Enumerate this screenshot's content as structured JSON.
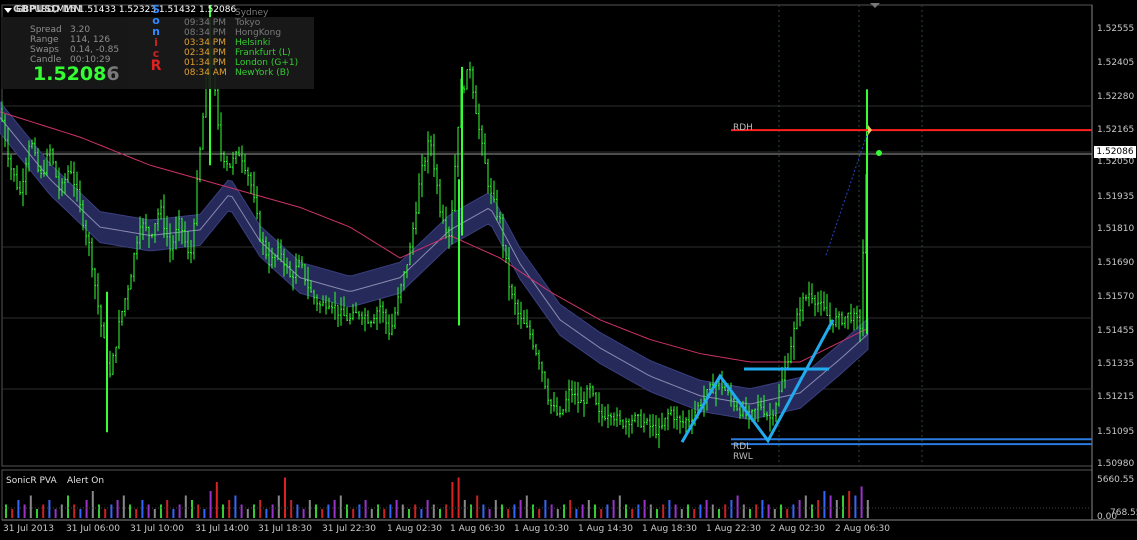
{
  "symbol_bar": {
    "text": "GBPUSD,M15  1.51433 1.52323 1.51432 1.52086"
  },
  "info_panel": {
    "pair_label": "GBPUSD  MN",
    "spread_label": "Spread",
    "spread_value": "3.20",
    "range_label": "Range",
    "range_value": "114, 126",
    "swaps_label": "Swaps",
    "swaps_value": "0.14, -0.85",
    "candle_label": "Candle",
    "candle_value": "00:10:29",
    "big_price_main": "1.5208",
    "big_price_last": "6",
    "sonic_letters": [
      "S",
      "o",
      "n",
      "i",
      "c",
      "R"
    ],
    "sonic_colors": [
      "#3388ff",
      "#3388ff",
      "#3388ff",
      "#cc2222",
      "#cc2222",
      "#dd2222"
    ],
    "sessions": [
      {
        "time": "",
        "name": "Sydney",
        "color": "#7a7a7a"
      },
      {
        "time": "09:34 PM",
        "name": "Tokyo",
        "color": "#7a7a7a"
      },
      {
        "time": "08:34 PM",
        "name": "HongKong",
        "color": "#7a7a7a"
      },
      {
        "time": "03:34 PM",
        "name": "Helsinki",
        "color": "#33cc33"
      },
      {
        "time": "02:34 PM",
        "name": "Frankfurt  (L)",
        "color": "#33cc33"
      },
      {
        "time": "01:34 PM",
        "name": "London  (G+1)",
        "color": "#33cc33"
      },
      {
        "time": "08:34 AM",
        "name": "NewYork  (B)",
        "color": "#33cc33"
      }
    ],
    "session_time_colors": [
      "#7a7a7a",
      "#7a7a7a",
      "#7a7a7a",
      "#e0a030",
      "#e0a030",
      "#e0a030",
      "#e0a030"
    ]
  },
  "price_axis": {
    "labels": [
      "1.52555",
      "1.52405",
      "1.52280",
      "1.52165",
      "1.52050",
      "1.51935",
      "1.51810",
      "1.51690",
      "1.51570",
      "1.51455",
      "1.51335",
      "1.51215",
      "1.51095",
      "1.50980"
    ],
    "current_price": "1.52086"
  },
  "time_axis": {
    "labels": [
      "31 Jul 2013",
      "31 Jul 06:00",
      "31 Jul 10:00",
      "31 Jul 14:00",
      "31 Jul 18:30",
      "31 Jul 22:30",
      "1 Aug 02:30",
      "1 Aug 06:30",
      "1 Aug 10:30",
      "1 Aug 14:30",
      "1 Aug 18:30",
      "1 Aug 22:30",
      "2 Aug 02:30",
      "2 Aug 06:30"
    ]
  },
  "levels": {
    "rdh": "RDH",
    "rdl": "RDL",
    "rwl": "RWL"
  },
  "indicator": {
    "name": "SonicR PVA",
    "alert": "Alert On",
    "max_label": "5660.55",
    "min_label": "768.55",
    "zero_label": "0.00"
  },
  "colors": {
    "background": "#000000",
    "candle": "#33ff33",
    "band_fill": "#262a5a",
    "band_edge": "#3a3f80",
    "ma_line": "#cc3366",
    "rdh_line": "#ff2020",
    "support_line": "#2a7adf",
    "pattern_line": "#22aaee",
    "grid": "#1c3a1c"
  },
  "chart_data": {
    "type": "candlestick",
    "symbol": "GBPUSD",
    "timeframe": "M15",
    "ohlc_current": {
      "open": 1.51433,
      "high": 1.52323,
      "low": 1.51432,
      "close": 1.52086
    },
    "ylim": [
      1.5098,
      1.5262
    ],
    "close_path": [
      [
        0,
        1.5225
      ],
      [
        10,
        1.5205
      ],
      [
        20,
        1.5195
      ],
      [
        30,
        1.5215
      ],
      [
        40,
        1.52
      ],
      [
        50,
        1.521
      ],
      [
        60,
        1.5195
      ],
      [
        70,
        1.5205
      ],
      [
        80,
        1.519
      ],
      [
        90,
        1.5175
      ],
      [
        100,
        1.515
      ],
      [
        110,
        1.513
      ],
      [
        120,
        1.515
      ],
      [
        130,
        1.5165
      ],
      [
        140,
        1.5185
      ],
      [
        150,
        1.518
      ],
      [
        160,
        1.519
      ],
      [
        170,
        1.5175
      ],
      [
        180,
        1.5185
      ],
      [
        190,
        1.517
      ],
      [
        200,
        1.521
      ],
      [
        210,
        1.525
      ],
      [
        220,
        1.521
      ],
      [
        230,
        1.5205
      ],
      [
        240,
        1.521
      ],
      [
        250,
        1.52
      ],
      [
        260,
        1.518
      ],
      [
        270,
        1.517
      ],
      [
        280,
        1.5175
      ],
      [
        290,
        1.5165
      ],
      [
        300,
        1.517
      ],
      [
        310,
        1.516
      ],
      [
        320,
        1.5155
      ],
      [
        330,
        1.5157
      ],
      [
        340,
        1.5152
      ],
      [
        350,
        1.515
      ],
      [
        360,
        1.5153
      ],
      [
        370,
        1.515
      ],
      [
        380,
        1.5155
      ],
      [
        390,
        1.5145
      ],
      [
        400,
        1.516
      ],
      [
        410,
        1.5175
      ],
      [
        420,
        1.52
      ],
      [
        430,
        1.5215
      ],
      [
        440,
        1.519
      ],
      [
        450,
        1.518
      ],
      [
        460,
        1.523
      ],
      [
        470,
        1.524
      ],
      [
        480,
        1.5215
      ],
      [
        490,
        1.5195
      ],
      [
        500,
        1.5185
      ],
      [
        510,
        1.516
      ],
      [
        520,
        1.515
      ],
      [
        530,
        1.5145
      ],
      [
        540,
        1.5135
      ],
      [
        550,
        1.512
      ],
      [
        560,
        1.5115
      ],
      [
        570,
        1.5125
      ],
      [
        580,
        1.512
      ],
      [
        590,
        1.5125
      ],
      [
        600,
        1.5115
      ],
      [
        610,
        1.5118
      ],
      [
        620,
        1.5113
      ],
      [
        630,
        1.5115
      ],
      [
        640,
        1.5114
      ],
      [
        650,
        1.5112
      ],
      [
        660,
        1.511
      ],
      [
        670,
        1.5118
      ],
      [
        680,
        1.5113
      ],
      [
        690,
        1.5115
      ],
      [
        700,
        1.512
      ],
      [
        710,
        1.5125
      ],
      [
        720,
        1.5128
      ],
      [
        730,
        1.5122
      ],
      [
        740,
        1.5118
      ],
      [
        750,
        1.5115
      ],
      [
        760,
        1.512
      ],
      [
        770,
        1.5115
      ],
      [
        780,
        1.5125
      ],
      [
        790,
        1.514
      ],
      [
        800,
        1.5155
      ],
      [
        810,
        1.516
      ],
      [
        820,
        1.5155
      ],
      [
        830,
        1.515
      ],
      [
        840,
        1.515
      ],
      [
        850,
        1.5152
      ],
      [
        860,
        1.5148
      ],
      [
        867,
        1.5209
      ]
    ],
    "band_center": [
      [
        0,
        1.5222
      ],
      [
        50,
        1.52
      ],
      [
        100,
        1.5183
      ],
      [
        150,
        1.518
      ],
      [
        200,
        1.5182
      ],
      [
        230,
        1.5195
      ],
      [
        260,
        1.5178
      ],
      [
        300,
        1.5165
      ],
      [
        350,
        1.516
      ],
      [
        400,
        1.5165
      ],
      [
        450,
        1.5182
      ],
      [
        490,
        1.519
      ],
      [
        520,
        1.517
      ],
      [
        560,
        1.515
      ],
      [
        600,
        1.514
      ],
      [
        650,
        1.513
      ],
      [
        700,
        1.5123
      ],
      [
        750,
        1.512
      ],
      [
        800,
        1.5124
      ],
      [
        840,
        1.5136
      ],
      [
        868,
        1.5145
      ]
    ],
    "band_width": 0.00055,
    "ma_line": [
      [
        0,
        1.5224
      ],
      [
        80,
        1.5215
      ],
      [
        150,
        1.5205
      ],
      [
        200,
        1.52
      ],
      [
        250,
        1.5195
      ],
      [
        300,
        1.519
      ],
      [
        350,
        1.5183
      ],
      [
        400,
        1.5172
      ],
      [
        450,
        1.518
      ],
      [
        500,
        1.5172
      ],
      [
        550,
        1.516
      ],
      [
        600,
        1.515
      ],
      [
        650,
        1.5143
      ],
      [
        700,
        1.5138
      ],
      [
        750,
        1.5135
      ],
      [
        800,
        1.5135
      ],
      [
        868,
        1.5147
      ]
    ],
    "levels": {
      "RDH": 1.52175,
      "RDL": 1.51075,
      "RWL": 1.51058
    },
    "pattern_zigzag": [
      [
        682,
        1.51065
      ],
      [
        720,
        1.513
      ],
      [
        768,
        1.5107
      ],
      [
        833,
        1.515
      ]
    ],
    "pattern_neckline": [
      [
        744,
        1.51325
      ],
      [
        829,
        1.51325
      ]
    ],
    "projection": [
      [
        826,
        1.5173
      ],
      [
        868,
        1.5217
      ]
    ],
    "volume": [
      3,
      2,
      4,
      3,
      5,
      2,
      3,
      4,
      2,
      3,
      5,
      3,
      2,
      4,
      6,
      3,
      2,
      3,
      4,
      5,
      3,
      2,
      4,
      3,
      2,
      3,
      4,
      2,
      3,
      5,
      4,
      3,
      2,
      6,
      8,
      3,
      4,
      5,
      3,
      2,
      3,
      4,
      2,
      3,
      5,
      9,
      4,
      3,
      2,
      4,
      3,
      2,
      3,
      4,
      5,
      3,
      2,
      3,
      4,
      2,
      3,
      2,
      3,
      4,
      3,
      2,
      3,
      2,
      4,
      3,
      2,
      3,
      8,
      9,
      4,
      3,
      5,
      3,
      2,
      4,
      3,
      2,
      3,
      4,
      5,
      3,
      2,
      4,
      3,
      2,
      3,
      4,
      2,
      3,
      4,
      3,
      2,
      3,
      4,
      5,
      3,
      2,
      3,
      4,
      3,
      2,
      3,
      4,
      3,
      2,
      3,
      2,
      3,
      4,
      3,
      2,
      3,
      4,
      5,
      3,
      2,
      3,
      4,
      3,
      2,
      3,
      2,
      3,
      4,
      5,
      3,
      4,
      6,
      5,
      4,
      5,
      6,
      5,
      7,
      4,
      5
    ]
  }
}
